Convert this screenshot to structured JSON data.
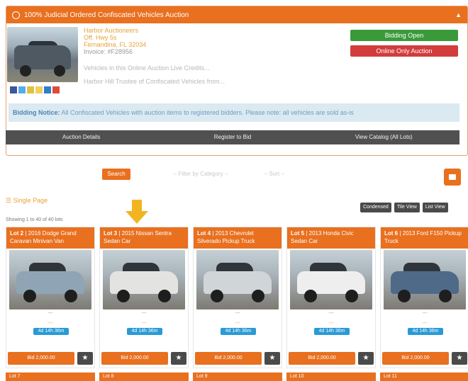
{
  "colors": {
    "accent": "#e8701f",
    "green": "#3a9a3a",
    "red": "#d23c3c",
    "dark": "#4a4a4a",
    "blue": "#2a9ad6"
  },
  "panel": {
    "title": "100% Judicial Ordered Confiscated Vehicles Auction",
    "seller_name": "Harbor Auctioneers",
    "seller_line2": "Off. Hwy 5s",
    "seller_line3": "Fernandina, FL 32034",
    "seller_line4": "Invoice: #F28956",
    "desc_line1": "Vehicles in this Online Auction Live Credits...",
    "desc_line2": "Harbor Hill Trustee of Confiscated Vehicles from...",
    "btn_green": "Bidding Open",
    "btn_red": "Online Only Auction",
    "notice_label": "Bidding Notice:",
    "notice_text": "All Confiscated Vehicles with auction items to registered bidders. Please note: all vehicles are sold as-is",
    "tabs": [
      "Auction Details",
      "Register to Bid",
      "View Catalog (All Lots)"
    ]
  },
  "filters": {
    "search_label": "Search",
    "filter_1": "-- Filter by Category --",
    "filter_2": "-- Sort --"
  },
  "single_page_label": "Single Page",
  "showing_text": "Showing 1 to 40 of 40 lots",
  "views": [
    "Condensed",
    "Tile View",
    "List View"
  ],
  "lots": [
    {
      "lot": "Lot 2",
      "title": "2016 Dodge Grand Caravan Minivan Van",
      "odo": "---",
      "bid": "---",
      "time": "4d 14h 36m",
      "bid_btn": "Bid 2,000.00",
      "color": "#8fa5b5"
    },
    {
      "lot": "Lot 3",
      "title": "2015 Nissan Sentra Sedan Car",
      "odo": "---",
      "bid": "---",
      "time": "4d 14h 36m",
      "bid_btn": "Bid 2,000.00",
      "color": "#e3e4e2"
    },
    {
      "lot": "Lot 4",
      "title": "2013 Chevrolet Silverado Pickup Truck",
      "odo": "---",
      "bid": "---",
      "time": "4d 14h 36m",
      "bid_btn": "Bid 2,000.00",
      "color": "#d0d5d8"
    },
    {
      "lot": "Lot 5",
      "title": "2013 Honda Civic Sedan Car",
      "odo": "---",
      "bid": "---",
      "time": "4d 14h 36m",
      "bid_btn": "Bid 2,000.00",
      "color": "#eeeeee"
    },
    {
      "lot": "Lot 6",
      "title": "2013 Ford F150 Pickup Truck",
      "odo": "---",
      "bid": "---",
      "time": "4d 14h 36m",
      "bid_btn": "Bid 2,000.00",
      "color": "#4e6a88"
    }
  ],
  "next_row": [
    "Lot 7",
    "Lot 8",
    "Lot 9",
    "Lot 10",
    "Lot 11"
  ]
}
